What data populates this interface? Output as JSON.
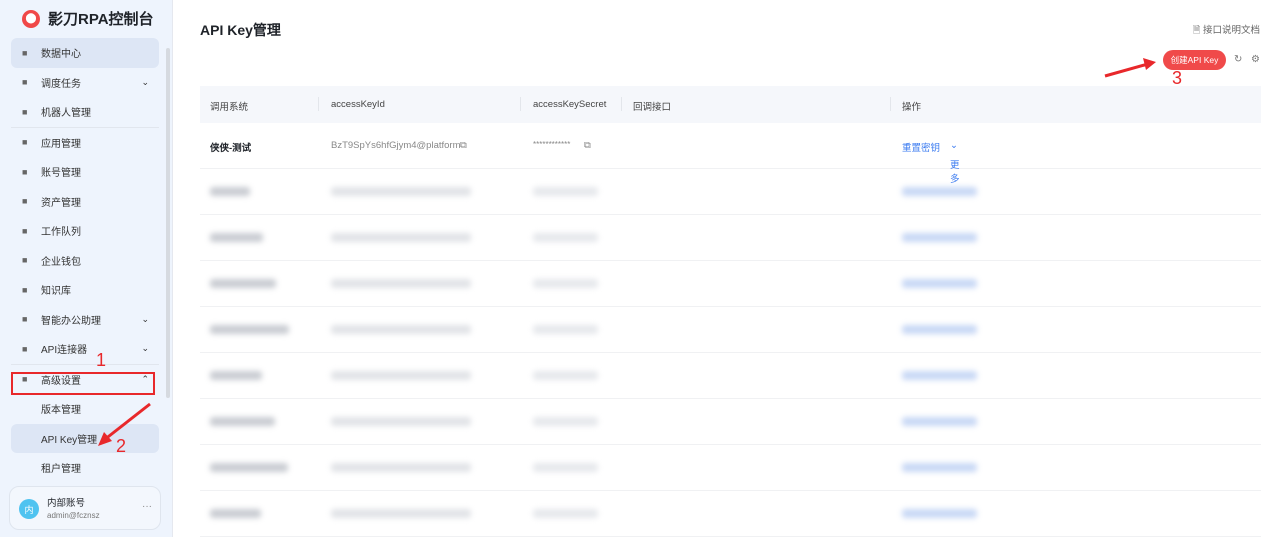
{
  "app": {
    "title": "影刀RPA控制台"
  },
  "sidebar": {
    "items": [
      {
        "label": "数据中心",
        "icon": "chart-icon"
      },
      {
        "label": "调度任务",
        "icon": "grid-icon",
        "chevron": "⌄"
      },
      {
        "label": "机器人管理",
        "icon": "robot-icon"
      },
      {
        "label": "应用管理",
        "icon": "cube-icon"
      },
      {
        "label": "账号管理",
        "icon": "users-icon"
      },
      {
        "label": "资产管理",
        "icon": "database-icon"
      },
      {
        "label": "工作队列",
        "icon": "list-icon"
      },
      {
        "label": "企业钱包",
        "icon": "wallet-icon"
      },
      {
        "label": "知识库",
        "icon": "book-icon"
      },
      {
        "label": "智能办公助理",
        "icon": "chat-icon",
        "chevron": "⌄"
      },
      {
        "label": "API连接器",
        "icon": "connector-icon",
        "chevron": "⌄"
      },
      {
        "label": "高级设置",
        "icon": "settings-icon",
        "chevron": "⌃"
      }
    ],
    "sub_items": [
      {
        "label": "版本管理"
      },
      {
        "label": "API Key管理"
      },
      {
        "label": "租户管理"
      }
    ],
    "user": {
      "avatar": "内",
      "name": "内部账号",
      "email": "admin@fcznsz",
      "more": "···"
    }
  },
  "page": {
    "title": "API Key管理",
    "doc_link": "接口说明文档",
    "create_button": "创建API Key"
  },
  "annotations": [
    "1",
    "2",
    "3"
  ],
  "table": {
    "headers": [
      "调用系统",
      "accessKeyId",
      "accessKeySecret",
      "回调接口",
      "操作"
    ],
    "rows": [
      {
        "system": "侠侠-测试",
        "access_key_id": "BzT9SpYs6hfGjym4@platform",
        "secret": "************",
        "callback": "",
        "actions": [
          "重置密钥",
          "更多"
        ]
      }
    ]
  },
  "colors": {
    "accent": "#f04a4a",
    "link": "#3b7bf0"
  }
}
